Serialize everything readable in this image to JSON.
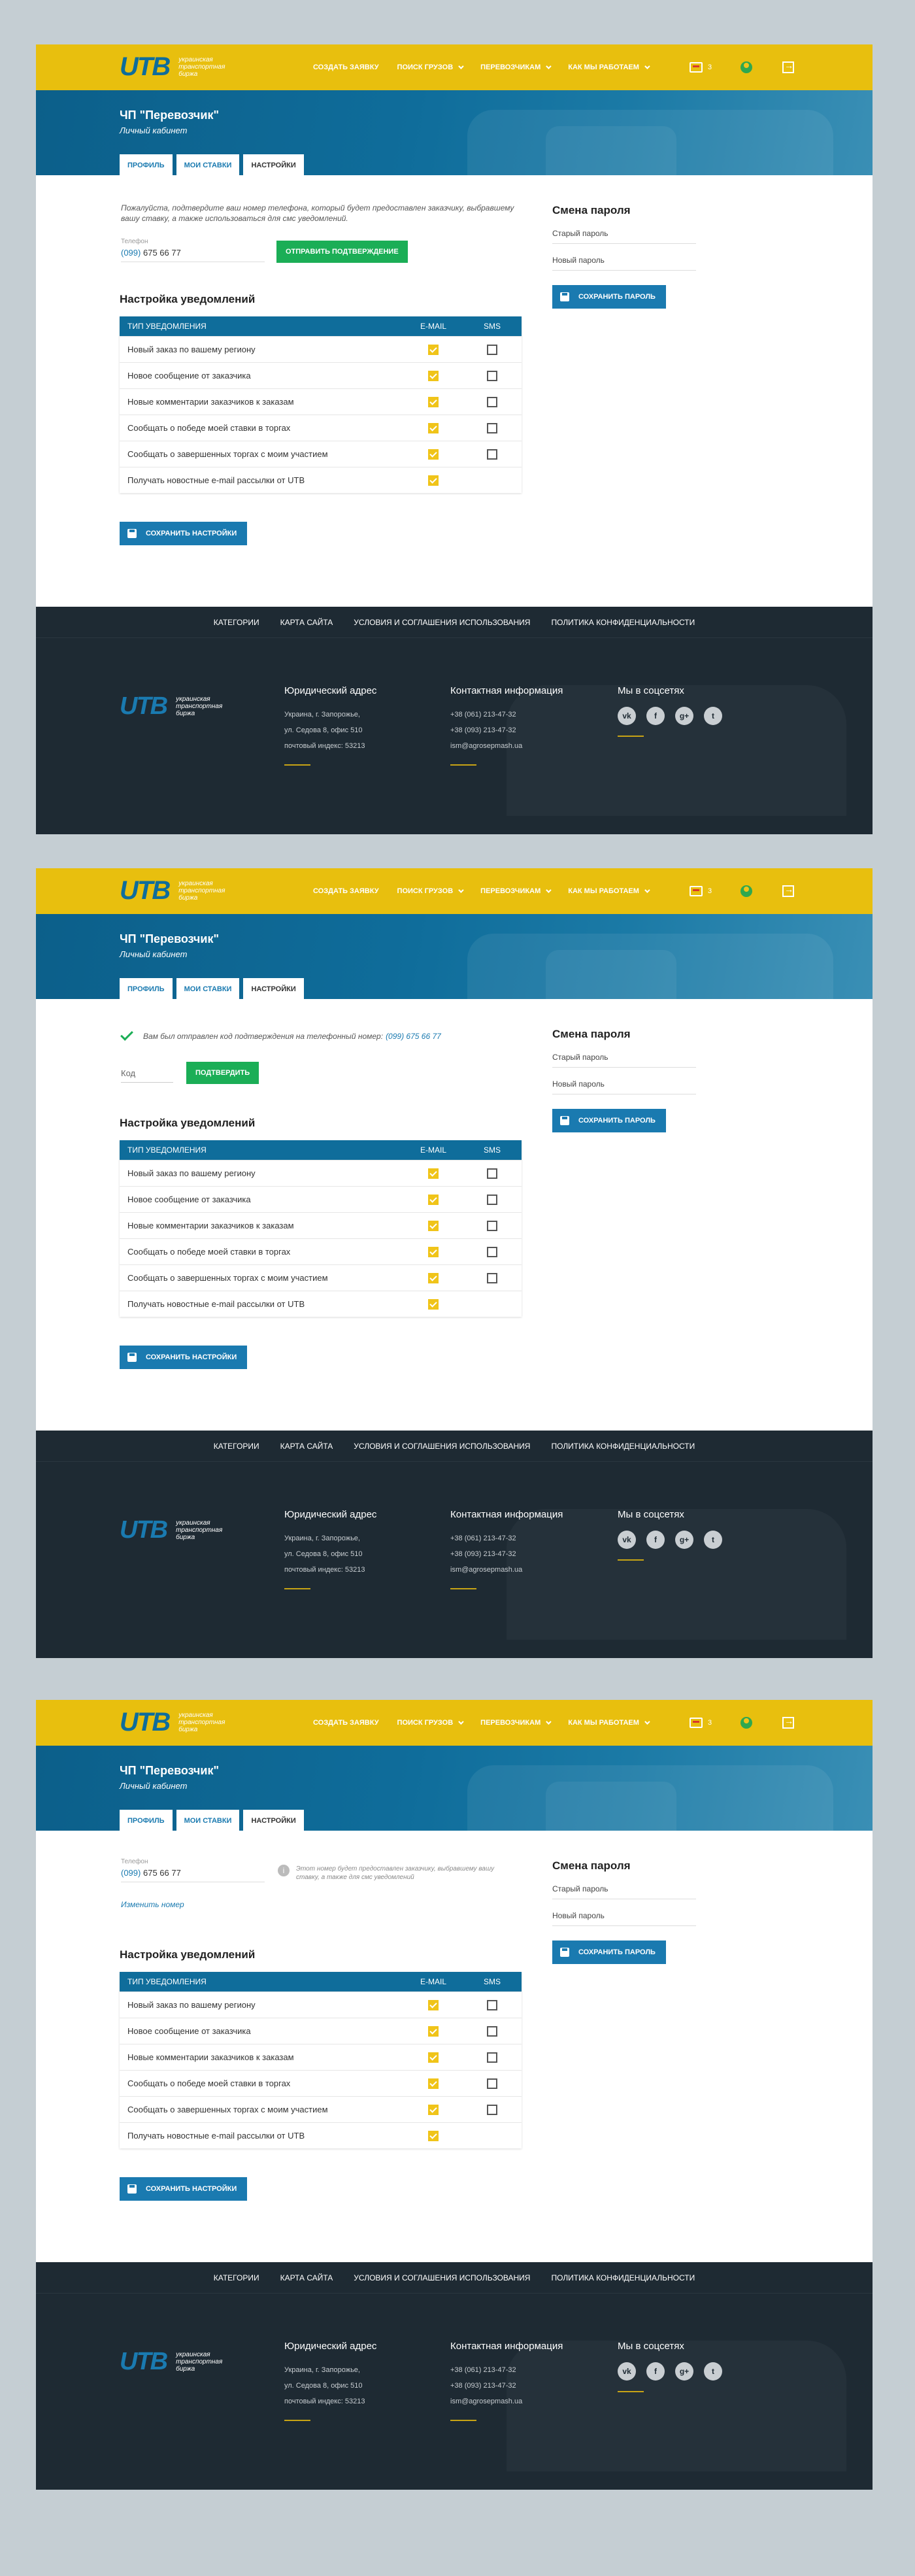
{
  "header": {
    "logo": "UTB",
    "logo_sub": "украинская транспортная биржа",
    "nav": [
      "СОЗДАТЬ ЗАЯВКУ",
      "ПОИСК ГРУЗОВ",
      "ПЕРЕВОЗЧИКАМ",
      "КАК МЫ РАБОТАЕМ"
    ],
    "message_count": "3"
  },
  "hero": {
    "company": "ЧП \"Перевозчик\"",
    "subtitle": "Личный кабинет",
    "tabs": [
      "ПРОФИЛЬ",
      "МОИ СТАВКИ",
      "НАСТРОЙКИ"
    ]
  },
  "v1": {
    "intro": "Пожалуйста, подтвердите ваш номер телефона, который будет предоставлен заказчику, выбравшему вашу ставку, а также использоваться для смс уведомлений.",
    "phone_label": "Телефон",
    "phone_code": "(099)",
    "phone_number": "675 66 77",
    "send_button": "ОТПРАВИТЬ ПОДТВЕРЖДЕНИЕ"
  },
  "v2": {
    "message": "Вам был отправлен код подтверждения на телефонный номер:",
    "message_number": "(099) 675 66 77",
    "code_placeholder": "Код",
    "confirm_button": "ПОДТВЕРДИТЬ"
  },
  "v3": {
    "phone_label": "Телефон",
    "phone_code": "(099)",
    "phone_number": "675 66 77",
    "info": "Этот номер будет предоставлен заказчику, выбравшему вашу ставку, а также для смс уведомлений",
    "change_link": "Изменить номер"
  },
  "notifications": {
    "title": "Настройка уведомлений",
    "col_type": "ТИП УВЕДОМЛЕНИЯ",
    "col_email": "E-MAIL",
    "col_sms": "SMS",
    "rows": [
      {
        "label": "Новый заказ по вашему региону",
        "email": true,
        "sms": false
      },
      {
        "label": "Новое сообщение от заказчика",
        "email": true,
        "sms": false
      },
      {
        "label": "Новые комментарии заказчиков к заказам",
        "email": true,
        "sms": false
      },
      {
        "label": "Сообщать о победе моей ставки в торгах",
        "email": true,
        "sms": false
      },
      {
        "label": "Сообщать о завершенных торгах с моим участием",
        "email": true,
        "sms": false
      },
      {
        "label": "Получать новостные e-mail рассылки от UTB",
        "email": true,
        "sms": null
      }
    ],
    "save_button": "СОХРАНИТЬ НАСТРОЙКИ"
  },
  "password": {
    "title": "Смена пароля",
    "old": "Старый пароль",
    "new": "Новый пароль",
    "save_button": "СОХРАНИТЬ ПАРОЛЬ"
  },
  "footer": {
    "links": [
      "КАТЕГОРИИ",
      "КАРТА САЙТА",
      "УСЛОВИЯ И СОГЛАШЕНИЯ ИСПОЛЬЗОВАНИЯ",
      "ПОЛИТИКА КОНФИДЕНЦИАЛЬНОСТИ"
    ],
    "legal_title": "Юридический адрес",
    "legal_lines": [
      "Украина, г. Запорожье,",
      "ул. Седова 8, офис 510",
      "почтовый индекс: 53213"
    ],
    "contact_title": "Контактная информация",
    "contact_lines": [
      "+38 (061) 213-47-32",
      "+38 (093) 213-47-32",
      "ism@agrosepmash.ua"
    ],
    "social_title": "Мы в соцсетях",
    "socials": [
      "vk",
      "f",
      "g+",
      "t"
    ]
  },
  "colors": {
    "yellow": "#e8bf0e",
    "blue": "#0f6d9b",
    "green": "#1bae56",
    "footer": "#1e2a33"
  }
}
